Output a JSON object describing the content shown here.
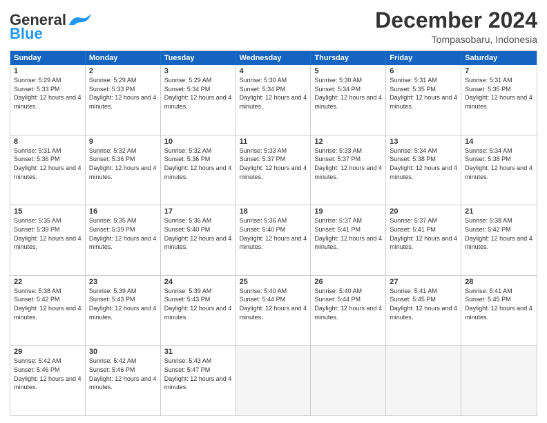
{
  "logo": {
    "text_general": "General",
    "text_blue": "Blue"
  },
  "header": {
    "month": "December 2024",
    "location": "Tompasobaru, Indonesia"
  },
  "days": [
    "Sunday",
    "Monday",
    "Tuesday",
    "Wednesday",
    "Thursday",
    "Friday",
    "Saturday"
  ],
  "weeks": [
    [
      {
        "day": "1",
        "sunrise": "5:29 AM",
        "sunset": "5:33 PM",
        "daylight": "12 hours and 4 minutes."
      },
      {
        "day": "2",
        "sunrise": "5:29 AM",
        "sunset": "5:33 PM",
        "daylight": "12 hours and 4 minutes."
      },
      {
        "day": "3",
        "sunrise": "5:29 AM",
        "sunset": "5:34 PM",
        "daylight": "12 hours and 4 minutes."
      },
      {
        "day": "4",
        "sunrise": "5:30 AM",
        "sunset": "5:34 PM",
        "daylight": "12 hours and 4 minutes."
      },
      {
        "day": "5",
        "sunrise": "5:30 AM",
        "sunset": "5:34 PM",
        "daylight": "12 hours and 4 minutes."
      },
      {
        "day": "6",
        "sunrise": "5:31 AM",
        "sunset": "5:35 PM",
        "daylight": "12 hours and 4 minutes."
      },
      {
        "day": "7",
        "sunrise": "5:31 AM",
        "sunset": "5:35 PM",
        "daylight": "12 hours and 4 minutes."
      }
    ],
    [
      {
        "day": "8",
        "sunrise": "5:31 AM",
        "sunset": "5:36 PM",
        "daylight": "12 hours and 4 minutes."
      },
      {
        "day": "9",
        "sunrise": "5:32 AM",
        "sunset": "5:36 PM",
        "daylight": "12 hours and 4 minutes."
      },
      {
        "day": "10",
        "sunrise": "5:32 AM",
        "sunset": "5:36 PM",
        "daylight": "12 hours and 4 minutes."
      },
      {
        "day": "11",
        "sunrise": "5:33 AM",
        "sunset": "5:37 PM",
        "daylight": "12 hours and 4 minutes."
      },
      {
        "day": "12",
        "sunrise": "5:33 AM",
        "sunset": "5:37 PM",
        "daylight": "12 hours and 4 minutes."
      },
      {
        "day": "13",
        "sunrise": "5:34 AM",
        "sunset": "5:38 PM",
        "daylight": "12 hours and 4 minutes."
      },
      {
        "day": "14",
        "sunrise": "5:34 AM",
        "sunset": "5:38 PM",
        "daylight": "12 hours and 4 minutes."
      }
    ],
    [
      {
        "day": "15",
        "sunrise": "5:35 AM",
        "sunset": "5:39 PM",
        "daylight": "12 hours and 4 minutes."
      },
      {
        "day": "16",
        "sunrise": "5:35 AM",
        "sunset": "5:39 PM",
        "daylight": "12 hours and 4 minutes."
      },
      {
        "day": "17",
        "sunrise": "5:36 AM",
        "sunset": "5:40 PM",
        "daylight": "12 hours and 4 minutes."
      },
      {
        "day": "18",
        "sunrise": "5:36 AM",
        "sunset": "5:40 PM",
        "daylight": "12 hours and 4 minutes."
      },
      {
        "day": "19",
        "sunrise": "5:37 AM",
        "sunset": "5:41 PM",
        "daylight": "12 hours and 4 minutes."
      },
      {
        "day": "20",
        "sunrise": "5:37 AM",
        "sunset": "5:41 PM",
        "daylight": "12 hours and 4 minutes."
      },
      {
        "day": "21",
        "sunrise": "5:38 AM",
        "sunset": "5:42 PM",
        "daylight": "12 hours and 4 minutes."
      }
    ],
    [
      {
        "day": "22",
        "sunrise": "5:38 AM",
        "sunset": "5:42 PM",
        "daylight": "12 hours and 4 minutes."
      },
      {
        "day": "23",
        "sunrise": "5:39 AM",
        "sunset": "5:43 PM",
        "daylight": "12 hours and 4 minutes."
      },
      {
        "day": "24",
        "sunrise": "5:39 AM",
        "sunset": "5:43 PM",
        "daylight": "12 hours and 4 minutes."
      },
      {
        "day": "25",
        "sunrise": "5:40 AM",
        "sunset": "5:44 PM",
        "daylight": "12 hours and 4 minutes."
      },
      {
        "day": "26",
        "sunrise": "5:40 AM",
        "sunset": "5:44 PM",
        "daylight": "12 hours and 4 minutes."
      },
      {
        "day": "27",
        "sunrise": "5:41 AM",
        "sunset": "5:45 PM",
        "daylight": "12 hours and 4 minutes."
      },
      {
        "day": "28",
        "sunrise": "5:41 AM",
        "sunset": "5:45 PM",
        "daylight": "12 hours and 4 minutes."
      }
    ],
    [
      {
        "day": "29",
        "sunrise": "5:42 AM",
        "sunset": "5:46 PM",
        "daylight": "12 hours and 4 minutes."
      },
      {
        "day": "30",
        "sunrise": "5:42 AM",
        "sunset": "5:46 PM",
        "daylight": "12 hours and 4 minutes."
      },
      {
        "day": "31",
        "sunrise": "5:43 AM",
        "sunset": "5:47 PM",
        "daylight": "12 hours and 4 minutes."
      },
      null,
      null,
      null,
      null
    ]
  ]
}
